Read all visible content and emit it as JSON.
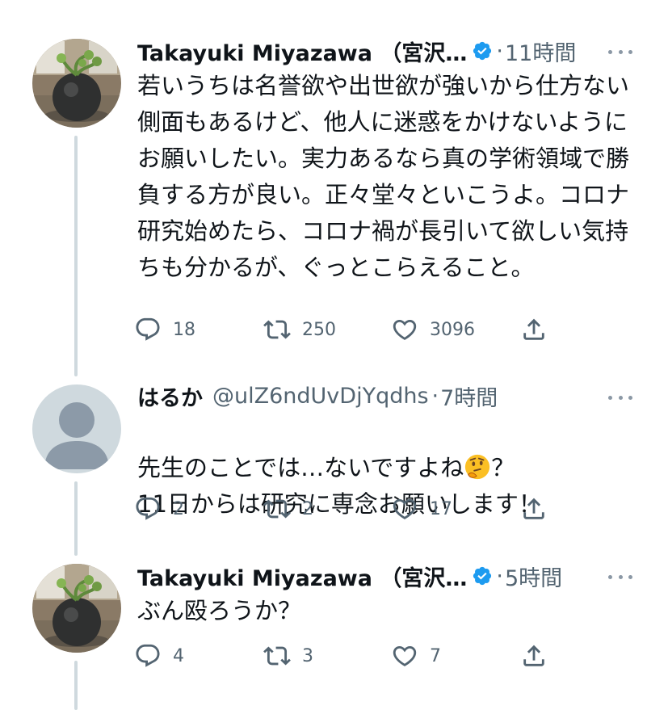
{
  "tweets": [
    {
      "name": "Takayuki Miyazawa （宮沢…",
      "handle": "",
      "time": "11時間",
      "text": "若いうちは名誉欲や出世欲が強いから仕方ない側面もあるけど、他人に迷惑をかけないようにお願いしたい。実力あるなら真の学術領域で勝負する方が良い。正々堂々といこうよ。コロナ研究始めたら、コロナ禍が長引いて欲しい気持ちも分かるが、ぐっとこらえること。",
      "replies": "18",
      "retweets": "250",
      "likes": "3096"
    },
    {
      "name": "はるか",
      "handle": "@ulZ6ndUvDjYqdhs",
      "time": "7時間",
      "text_before_emoji": "先生のことでは…ないですよね",
      "text_after_emoji": "？\n11日からは研究に専念お願いします！",
      "replies": "2",
      "retweets": "2",
      "likes": "17"
    },
    {
      "name": "Takayuki Miyazawa （宮沢…",
      "handle": "",
      "time": "5時間",
      "text": "ぶん殴ろうか？",
      "replies": "4",
      "retweets": "3",
      "likes": "7"
    }
  ],
  "icons": {
    "verified": "verified-badge-icon",
    "more": "more-icon",
    "reply": "reply-icon",
    "retweet": "retweet-icon",
    "like": "like-icon",
    "share": "share-icon",
    "emoji": "thinking-face-emoji"
  },
  "colors": {
    "verified": "#1d9bf0",
    "secondary_text": "#536471",
    "thread_line": "#cfd9de",
    "default_avatar_bg": "#cfd9de",
    "default_avatar_fg": "#8c9aa8"
  }
}
